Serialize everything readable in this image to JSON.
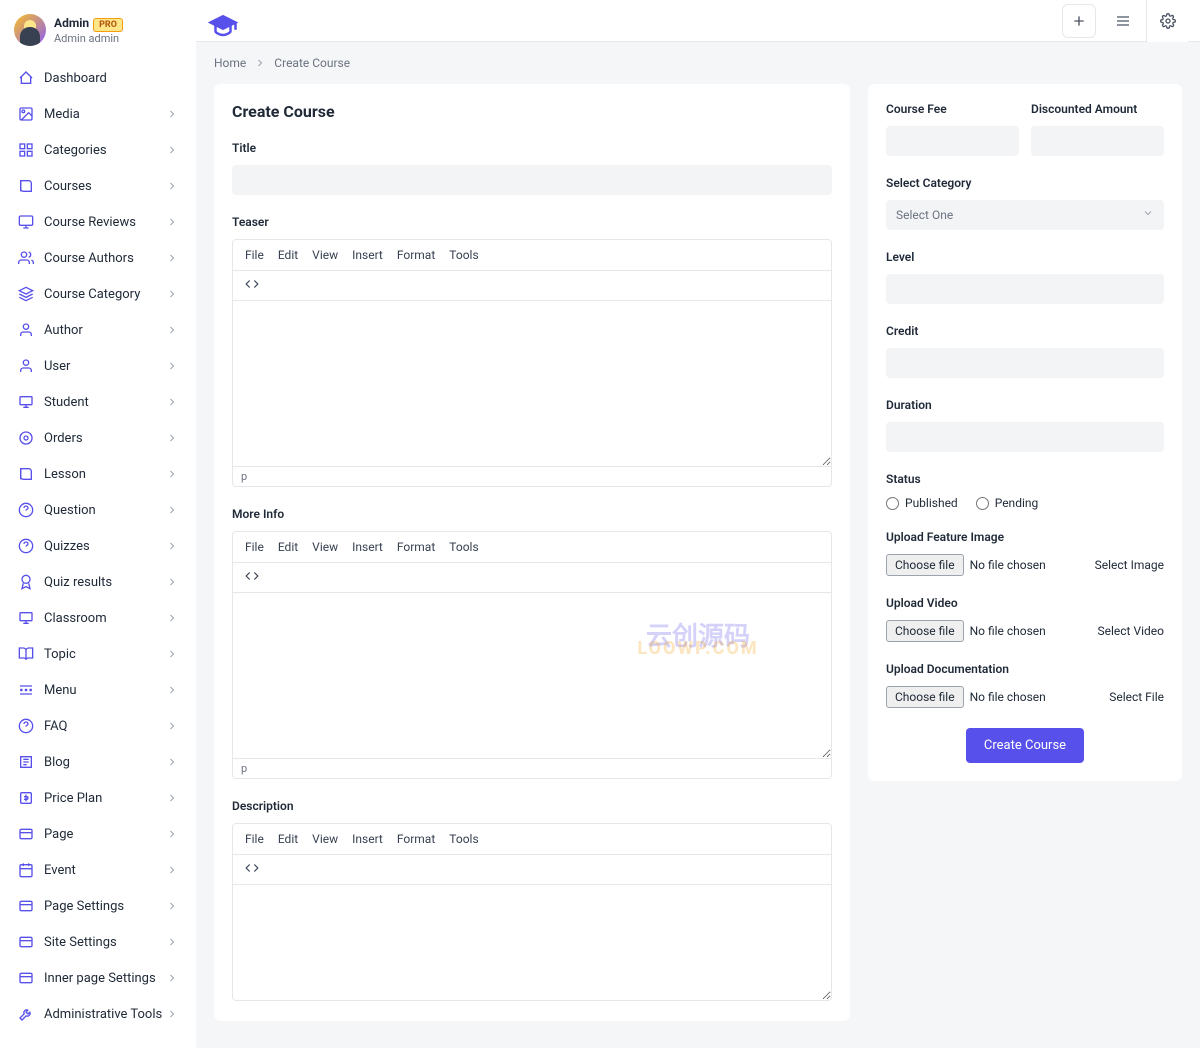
{
  "user": {
    "name": "Admin",
    "role": "Admin admin",
    "badge": "PRO"
  },
  "nav": [
    {
      "label": "Dashboard",
      "i": "home",
      "c": false
    },
    {
      "label": "Media",
      "i": "image",
      "c": true
    },
    {
      "label": "Categories",
      "i": "grid",
      "c": true
    },
    {
      "label": "Courses",
      "i": "book",
      "c": true
    },
    {
      "label": "Course Reviews",
      "i": "monitor",
      "c": true
    },
    {
      "label": "Course Authors",
      "i": "users",
      "c": true
    },
    {
      "label": "Course Category",
      "i": "layers",
      "c": true
    },
    {
      "label": "Author",
      "i": "user",
      "c": true
    },
    {
      "label": "User",
      "i": "user",
      "c": true
    },
    {
      "label": "Student",
      "i": "present",
      "c": true
    },
    {
      "label": "Orders",
      "i": "circle",
      "c": true
    },
    {
      "label": "Lesson",
      "i": "book",
      "c": true
    },
    {
      "label": "Question",
      "i": "help",
      "c": true
    },
    {
      "label": "Quizzes",
      "i": "help",
      "c": true
    },
    {
      "label": "Quiz results",
      "i": "award",
      "c": true
    },
    {
      "label": "Classroom",
      "i": "present",
      "c": true
    },
    {
      "label": "Topic",
      "i": "bookopen",
      "c": true
    },
    {
      "label": "Menu",
      "i": "menu",
      "c": true
    },
    {
      "label": "FAQ",
      "i": "help",
      "c": true
    },
    {
      "label": "Blog",
      "i": "news",
      "c": true
    },
    {
      "label": "Price Plan",
      "i": "dollar",
      "c": true
    },
    {
      "label": "Page",
      "i": "card",
      "c": true
    },
    {
      "label": "Event",
      "i": "calendar",
      "c": true
    },
    {
      "label": "Page Settings",
      "i": "card",
      "c": true
    },
    {
      "label": "Site Settings",
      "i": "card",
      "c": true
    },
    {
      "label": "Inner page Settings",
      "i": "card",
      "c": true
    },
    {
      "label": "Administrative Tools",
      "i": "tools",
      "c": true
    }
  ],
  "crumbs": {
    "home": "Home",
    "page": "Create Course"
  },
  "page": {
    "title": "Create Course"
  },
  "editor": {
    "menu": [
      "File",
      "Edit",
      "View",
      "Insert",
      "Format",
      "Tools"
    ],
    "path": "p"
  },
  "form": {
    "title_label": "Title",
    "teaser_label": "Teaser",
    "moreinfo_label": "More Info",
    "desc_label": "Description",
    "fee_label": "Course Fee",
    "disc_label": "Discounted Amount",
    "cat_label": "Select Category",
    "cat_placeholder": "Select One",
    "level_label": "Level",
    "credit_label": "Credit",
    "duration_label": "Duration",
    "status_label": "Status",
    "published": "Published",
    "pending": "Pending",
    "upimg_label": "Upload Feature Image",
    "upvid_label": "Upload Video",
    "updoc_label": "Upload Documentation",
    "choose": "Choose file",
    "nofile": "No file chosen",
    "selimg": "Select Image",
    "selvid": "Select Video",
    "selfile": "Select File",
    "submit": "Create Course"
  },
  "watermark": {
    "l1": "云创源码",
    "l2": "LOOWP.COM"
  }
}
